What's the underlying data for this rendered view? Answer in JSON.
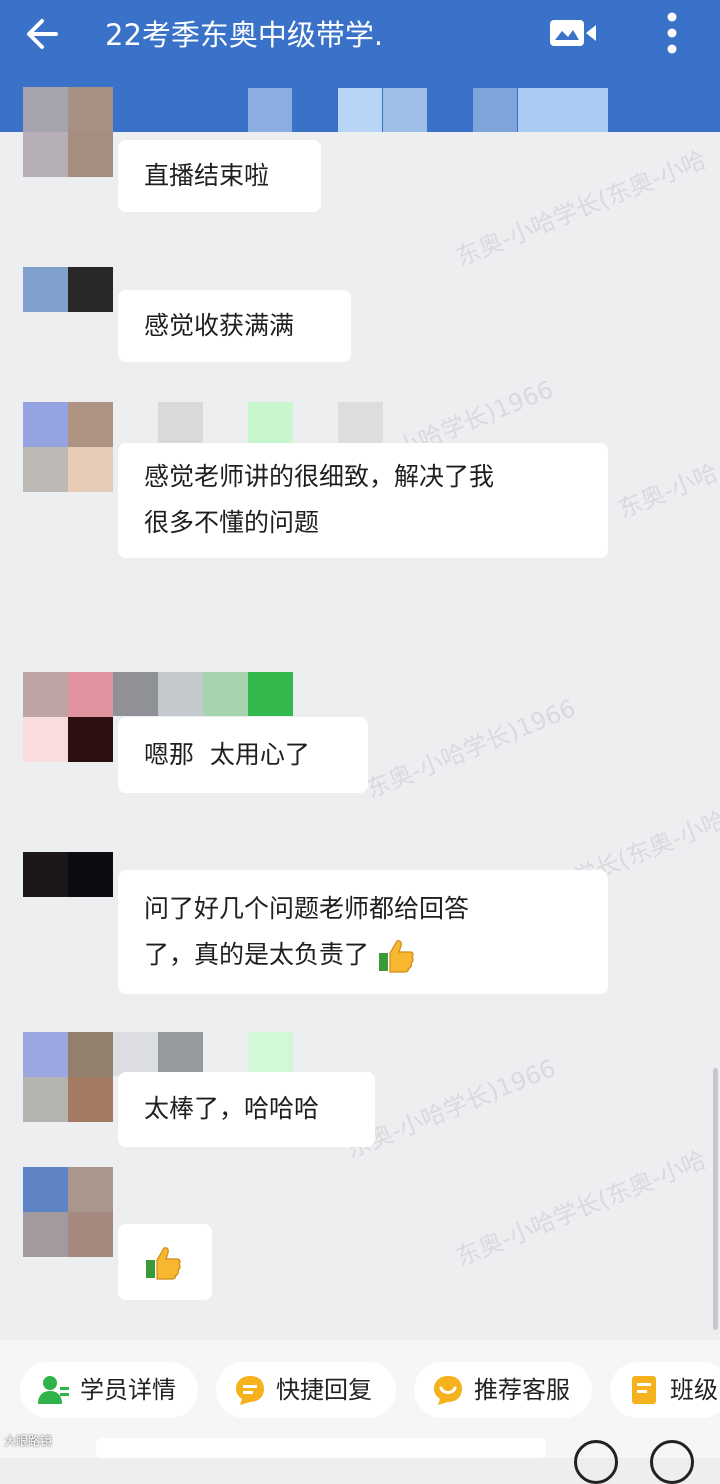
{
  "header": {
    "title": "22考季东奥中级带学.",
    "back_icon": "arrow-left-icon",
    "video_icon": "video-call-icon",
    "more_icon": "more-vertical-icon",
    "color": "#3a71c9"
  },
  "watermark": {
    "lines": [
      "东奥-小哈学长(东奥-小哈",
      "小哈学长)1966",
      "东奥-小哈",
      "东奥-小哈学长)1966",
      "东奥-小哈学长(东奥-小哈",
      "东奥-小哈学长)1966",
      "东奥-小哈学长(东奥-小哈"
    ]
  },
  "messages": [
    {
      "text": "直播结束啦"
    },
    {
      "text": "感觉收获满满"
    },
    {
      "line1": "感觉老师讲的很细致，解决了我",
      "line2": "很多不懂的问题"
    },
    {
      "text": "嗯那  太用心了"
    },
    {
      "line1": "问了好几个问题老师都给回答",
      "line2": "了，真的是太负责了",
      "emoji": "thumbs-up-icon"
    },
    {
      "text": "太棒了，哈哈哈"
    },
    {
      "emoji": "thumbs-up-icon"
    }
  ],
  "quick_actions": [
    {
      "label": "学员详情",
      "icon": "user-detail-icon"
    },
    {
      "label": "快捷回复",
      "icon": "quick-reply-icon"
    },
    {
      "label": "推荐客服",
      "icon": "customer-service-icon"
    },
    {
      "label": "班级",
      "icon": "class-note-icon"
    }
  ],
  "source_mark": "大眼路镜"
}
